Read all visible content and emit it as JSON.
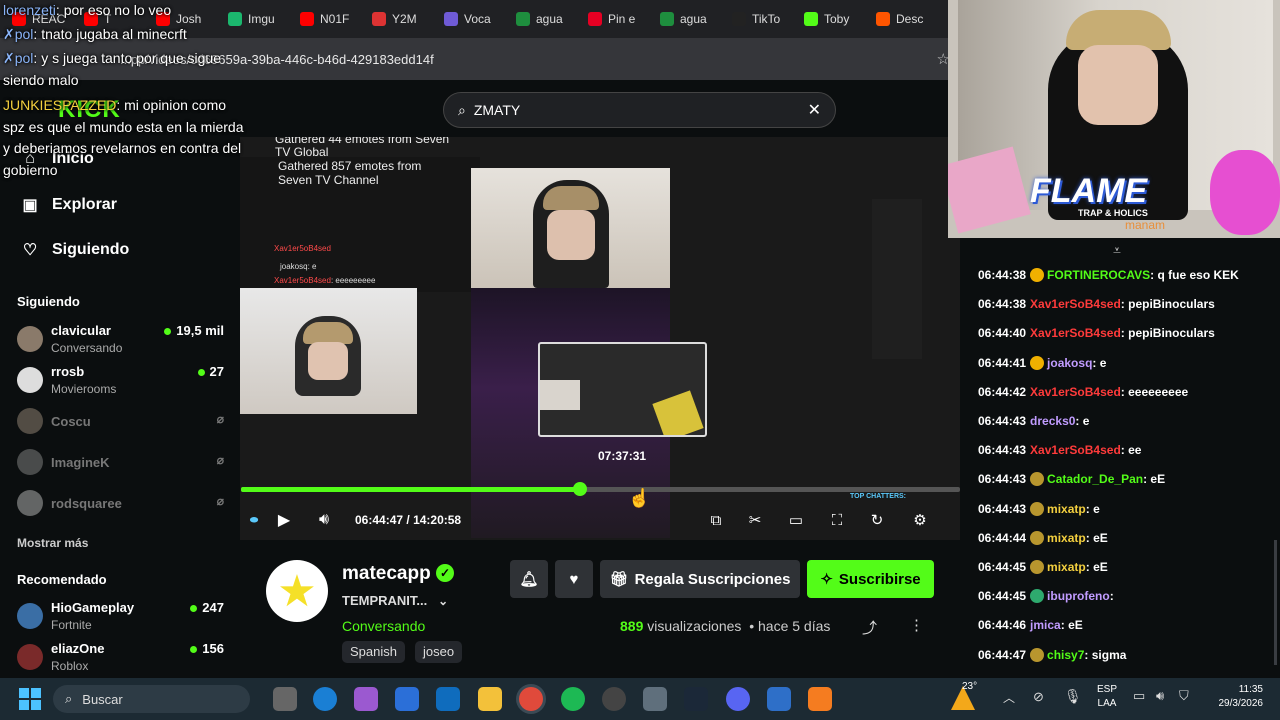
{
  "browser": {
    "tabs": [
      {
        "label": "REAC",
        "icon": "youtube-icon",
        "color": "#ff0000"
      },
      {
        "label": "T",
        "icon": "youtube-icon",
        "color": "#ff0000"
      },
      {
        "label": "Josh",
        "icon": "youtube-icon",
        "color": "#ff0000"
      },
      {
        "label": "Imgu",
        "icon": "imgur-icon",
        "color": "#1bb76e"
      },
      {
        "label": "N01F",
        "icon": "youtube-icon",
        "color": "#ff0000"
      },
      {
        "label": "Y2M",
        "icon": "y2mate-icon",
        "color": "#d33"
      },
      {
        "label": "Voca",
        "icon": "vocaroo-icon",
        "color": "#6f5bd6"
      },
      {
        "label": "agua",
        "icon": "drive-icon",
        "color": "#1e8e3e"
      },
      {
        "label": "Pin e",
        "icon": "pinterest-icon",
        "color": "#e60023"
      },
      {
        "label": "agua",
        "icon": "drive-icon",
        "color": "#1e8e3e"
      },
      {
        "label": "TikTo",
        "icon": "tiktok-icon",
        "color": "#222"
      },
      {
        "label": "Toby",
        "icon": "kick-icon",
        "color": "#53fc18"
      },
      {
        "label": "Desc",
        "icon": "soundcloud-icon",
        "color": "#ff5500"
      }
    ],
    "url": "...pp/videos/cd69659a-39ba-446c-b46d-429183edd14f"
  },
  "overlay_chat": [
    {
      "user": "lorenzeti",
      "text": "por eso no lo veo",
      "color": "#8ab4f8"
    },
    {
      "user": "pol",
      "text": ": tnato jugaba al minecrft",
      "color": "#8ab4f8"
    },
    {
      "user": "pol",
      "text": ": y s juega tanto por que sigue",
      "color": "#8ab4f8"
    },
    {
      "user": "",
      "text": "siendo malo",
      "color": "#fff"
    },
    {
      "user": "JUNKIESPAZZED",
      "text": ": mi opinion como",
      "color": "#f4d03f"
    },
    {
      "user": "",
      "text": "spz es que el mundo esta en la mierda",
      "color": "#fff"
    },
    {
      "user": "",
      "text": "y deberiamos revelarnos en contra del",
      "color": "#fff"
    },
    {
      "user": "",
      "text": "gobierno",
      "color": "#fff"
    }
  ],
  "search": {
    "value": "ZMATY"
  },
  "sidebar": {
    "nav": [
      {
        "label": "Inicio",
        "icon": "home-icon"
      },
      {
        "label": "Explorar",
        "icon": "compass-icon"
      },
      {
        "label": "Siguiendo",
        "icon": "heart-icon"
      }
    ],
    "following_title": "Siguiendo",
    "following": [
      {
        "name": "clavicular",
        "sub": "Conversando",
        "viewers": "19,5 mil",
        "live": true
      },
      {
        "name": "rrosb",
        "sub": "Movierooms",
        "viewers": "27",
        "live": true
      },
      {
        "name": "Coscu",
        "sub": "",
        "viewers": "",
        "live": false
      },
      {
        "name": "ImagineK",
        "sub": "",
        "viewers": "",
        "live": false
      },
      {
        "name": "rodsquaree",
        "sub": "",
        "viewers": "",
        "live": false
      }
    ],
    "show_more": "Mostrar más",
    "recommended_title": "Recomendado",
    "recommended": [
      {
        "name": "HioGameplay",
        "sub": "Fortnite",
        "viewers": "247"
      },
      {
        "name": "eliazOne",
        "sub": "Roblox",
        "viewers": "156"
      }
    ]
  },
  "video": {
    "elapsed": "06:44:47",
    "total": "14:20:58",
    "hover_time": "07:37:31",
    "progress": 0.472,
    "inner_text": [
      "Gathered 44 emotes from Seven TV Global",
      "Gathered 857 emotes from Seven TV Channel"
    ],
    "inner_chat": [
      {
        "user": "Xav1er5oB4sed",
        "text": ""
      },
      {
        "user": "joakosq",
        "text": ": e"
      },
      {
        "user": "Xav1er5oB4sed",
        "text": ": eeeeeeeee"
      }
    ],
    "top_chatters": "TOP CHATTERS:"
  },
  "stream": {
    "channel": "matecapp",
    "title": "TEMPRANIT...",
    "category": "Conversando",
    "tags": [
      "Spanish",
      "joseo"
    ],
    "views_count": "889",
    "views_label": "visualizaciones",
    "ago": "hace 5 días",
    "gift_label": "Regala Suscripciones",
    "subscribe_label": "Suscribirse"
  },
  "webcam": {
    "banner": "FLAME",
    "banner_sub": "TRAP & HOLICS",
    "partial_name": "manam"
  },
  "chat": [
    {
      "time": "06:44:38",
      "user": "FORTINEROCAVS",
      "text": ": q fue eso KEK",
      "color": "#53fc18",
      "badge": "#f0b000"
    },
    {
      "time": "06:44:38",
      "user": "Xav1erSoB4sed",
      "text": ": pepiBinoculars",
      "color": "#ff3b3b",
      "badge": ""
    },
    {
      "time": "06:44:40",
      "user": "Xav1erSoB4sed",
      "text": ": pepiBinoculars",
      "color": "#ff3b3b",
      "badge": ""
    },
    {
      "time": "06:44:41",
      "user": "joakosq",
      "text": ": e",
      "color": "#c19cff",
      "badge": "#f0b000"
    },
    {
      "time": "06:44:42",
      "user": "Xav1erSoB4sed",
      "text": ": eeeeeeeee",
      "color": "#ff3b3b",
      "badge": ""
    },
    {
      "time": "06:44:43",
      "user": "drecks0",
      "text": ": e",
      "color": "#c19cff",
      "badge": ""
    },
    {
      "time": "06:44:43",
      "user": "Xav1erSoB4sed",
      "text": ": ee",
      "color": "#ff3b3b",
      "badge": ""
    },
    {
      "time": "06:44:43",
      "user": "Catador_De_Pan",
      "text": ": eE",
      "color": "#53fc18",
      "badge": "#b8962e"
    },
    {
      "time": "06:44:43",
      "user": "mixatp",
      "text": ": e",
      "color": "#f4d03f",
      "badge": "#b8962e"
    },
    {
      "time": "06:44:44",
      "user": "mixatp",
      "text": ": eE",
      "color": "#f4d03f",
      "badge": "#b8962e"
    },
    {
      "time": "06:44:45",
      "user": "mixatp",
      "text": ": eE",
      "color": "#f4d03f",
      "badge": "#b8962e"
    },
    {
      "time": "06:44:45",
      "user": "ibuprofeno",
      "text": ":",
      "color": "#c19cff",
      "badge": "#2eaa6e"
    },
    {
      "time": "06:44:46",
      "user": "jmica",
      "text": ": eE",
      "color": "#c19cff",
      "badge": ""
    },
    {
      "time": "06:44:47",
      "user": "chisy7",
      "text": ": sigma",
      "color": "#53fc18",
      "badge": "#b8962e"
    }
  ],
  "taskbar": {
    "search_placeholder": "Buscar",
    "weather": "23°",
    "lang_top": "ESP",
    "lang_bottom": "LAA",
    "time": "11:35",
    "date": "29/3/2026"
  }
}
